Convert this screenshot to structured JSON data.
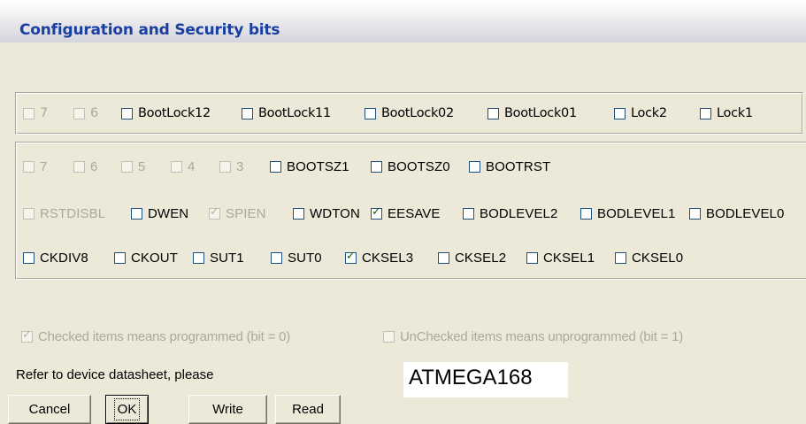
{
  "window": {
    "title": "Configuration and Security bits"
  },
  "lock_bits": [
    {
      "label": "7",
      "checked": false,
      "enabled": false
    },
    {
      "label": "6",
      "checked": false,
      "enabled": false
    },
    {
      "label": "BootLock12",
      "checked": false,
      "enabled": true
    },
    {
      "label": "BootLock11",
      "checked": false,
      "enabled": true
    },
    {
      "label": "BootLock02",
      "checked": false,
      "enabled": true
    },
    {
      "label": "BootLock01",
      "checked": false,
      "enabled": true
    },
    {
      "label": "Lock2",
      "checked": false,
      "enabled": true
    },
    {
      "label": "Lock1",
      "checked": false,
      "enabled": true
    }
  ],
  "ext_fuse": [
    {
      "label": "7",
      "checked": false,
      "enabled": false
    },
    {
      "label": "6",
      "checked": false,
      "enabled": false
    },
    {
      "label": "5",
      "checked": false,
      "enabled": false
    },
    {
      "label": "4",
      "checked": false,
      "enabled": false
    },
    {
      "label": "3",
      "checked": false,
      "enabled": false
    },
    {
      "label": "BOOTSZ1",
      "checked": false,
      "enabled": true
    },
    {
      "label": "BOOTSZ0",
      "checked": false,
      "enabled": true
    },
    {
      "label": "BOOTRST",
      "checked": false,
      "enabled": true
    }
  ],
  "high_fuse": [
    {
      "label": "RSTDISBL",
      "checked": false,
      "enabled": false
    },
    {
      "label": "DWEN",
      "checked": false,
      "enabled": true
    },
    {
      "label": "SPIEN",
      "checked": true,
      "enabled": false
    },
    {
      "label": "WDTON",
      "checked": false,
      "enabled": true
    },
    {
      "label": "EESAVE",
      "checked": true,
      "enabled": true
    },
    {
      "label": "BODLEVEL2",
      "checked": false,
      "enabled": true
    },
    {
      "label": "BODLEVEL1",
      "checked": false,
      "enabled": true
    },
    {
      "label": "BODLEVEL0",
      "checked": false,
      "enabled": true
    }
  ],
  "low_fuse": [
    {
      "label": "CKDIV8",
      "checked": false,
      "enabled": true
    },
    {
      "label": "CKOUT",
      "checked": false,
      "enabled": true
    },
    {
      "label": "SUT1",
      "checked": false,
      "enabled": true
    },
    {
      "label": "SUT0",
      "checked": false,
      "enabled": true
    },
    {
      "label": "CKSEL3",
      "checked": true,
      "enabled": true
    },
    {
      "label": "CKSEL2",
      "checked": false,
      "enabled": true
    },
    {
      "label": "CKSEL1",
      "checked": false,
      "enabled": true
    },
    {
      "label": "CKSEL0",
      "checked": false,
      "enabled": true
    }
  ],
  "legend": {
    "checked_text": "Checked items means programmed (bit = 0)",
    "unchecked_text": "UnChecked items means unprogrammed (bit = 1)"
  },
  "footer": {
    "refer_text": "Refer to device datasheet, please",
    "device_name": "ATMEGA168"
  },
  "buttons": {
    "cancel": "Cancel",
    "ok": "OK",
    "write": "Write",
    "read": "Read"
  },
  "check_glyph": "✓",
  "colors": {
    "title_text": "#1a3fa0",
    "dialog_bg": "#ece9d8",
    "check_color": "#215b15",
    "disabled_text": "#aaa99c"
  }
}
